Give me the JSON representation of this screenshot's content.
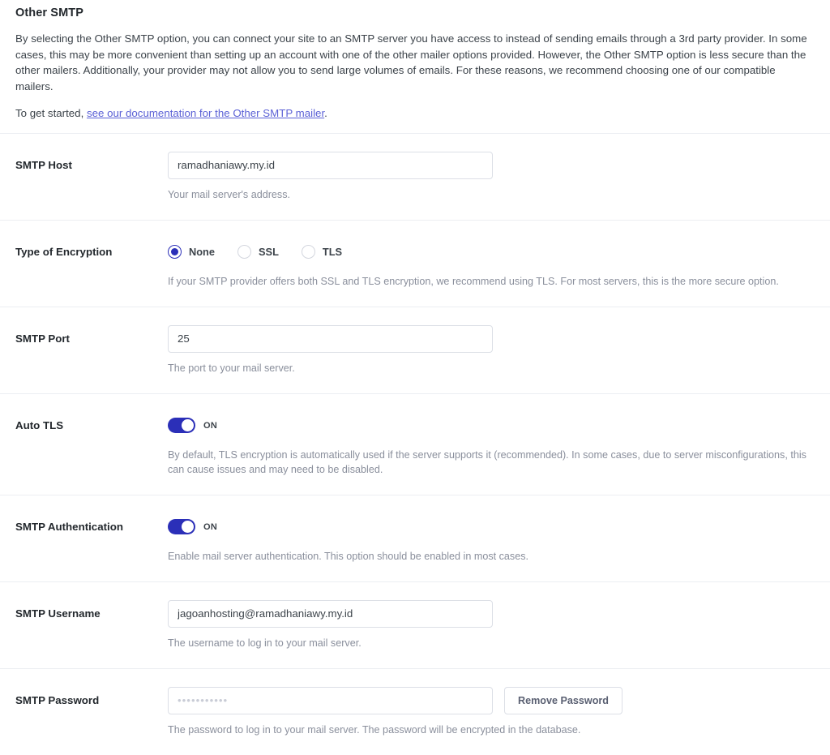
{
  "section": {
    "title": "Other SMTP",
    "paragraph": "By selecting the Other SMTP option, you can connect your site to an SMTP server you have access to instead of sending emails through a 3rd party provider. In some cases, this may be more convenient than setting up an account with one of the other mailer options provided. However, the Other SMTP option is less secure than the other mailers. Additionally, your provider may not allow you to send large volumes of emails. For these reasons, we recommend choosing one of our compatible mailers.",
    "get_started_prefix": "To get started, ",
    "get_started_link": "see our documentation for the Other SMTP mailer",
    "get_started_suffix": "."
  },
  "fields": {
    "smtp_host": {
      "label": "SMTP Host",
      "value": "ramadhaniawy.my.id",
      "description": "Your mail server's address."
    },
    "encryption": {
      "label": "Type of Encryption",
      "selected": "None",
      "options": [
        {
          "label": "None",
          "selected": true
        },
        {
          "label": "SSL",
          "selected": false
        },
        {
          "label": "TLS",
          "selected": false
        }
      ],
      "description": "If your SMTP provider offers both SSL and TLS encryption, we recommend using TLS. For most servers, this is the more secure option."
    },
    "smtp_port": {
      "label": "SMTP Port",
      "value": "25",
      "description": "The port to your mail server."
    },
    "auto_tls": {
      "label": "Auto TLS",
      "state": "ON",
      "enabled": true,
      "description": "By default, TLS encryption is automatically used if the server supports it (recommended). In some cases, due to server misconfigurations, this can cause issues and may need to be disabled."
    },
    "smtp_authentication": {
      "label": "SMTP Authentication",
      "state": "ON",
      "enabled": true,
      "description": "Enable mail server authentication. This option should be enabled in most cases."
    },
    "smtp_username": {
      "label": "SMTP Username",
      "value": "jagoanhosting@ramadhaniawy.my.id",
      "description": "The username to log in to your mail server."
    },
    "smtp_password": {
      "label": "SMTP Password",
      "placeholder": "•••••••••••",
      "value": "",
      "remove_button": "Remove Password",
      "description": "The password to log in to your mail server. The password will be encrypted in the database."
    }
  },
  "colors": {
    "accent": "#2b2fb8",
    "link": "#5b61d6",
    "heading": "#23282d",
    "body_text": "#3c434a",
    "muted_text": "#8a8f9c",
    "border": "#dcdfe6",
    "divider": "#eceef2"
  }
}
